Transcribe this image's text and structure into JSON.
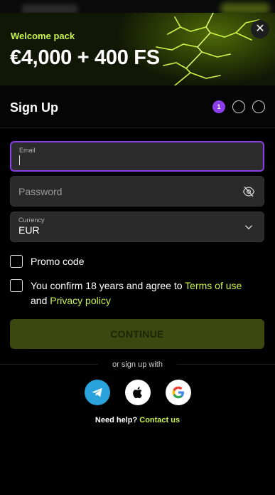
{
  "banner": {
    "welcome_label": "Welcome pack",
    "amount": "€4,000 + 400 FS",
    "close_symbol": "✕"
  },
  "header": {
    "title": "Sign Up",
    "steps": [
      "1",
      "",
      ""
    ]
  },
  "form": {
    "email": {
      "label": "Email",
      "value": ""
    },
    "password": {
      "placeholder": "Password"
    },
    "currency": {
      "label": "Currency",
      "value": "EUR"
    },
    "promo": {
      "label": "Promo code",
      "checked": false
    },
    "terms": {
      "text_before": "You confirm 18 years and agree to ",
      "terms_link": "Terms of use",
      "and_text": "and ",
      "privacy_link": "Privacy policy",
      "checked": false
    },
    "continue_label": "CONTINUE"
  },
  "social": {
    "divider_text": "or sign up with",
    "providers": [
      "telegram-icon",
      "apple-icon",
      "google-icon"
    ]
  },
  "help": {
    "text": "Need help? ",
    "link": "Contact us"
  },
  "colors": {
    "accent_purple": "#8a3de8",
    "accent_lime": "#c9f24a",
    "telegram_blue": "#2aa3dc"
  }
}
